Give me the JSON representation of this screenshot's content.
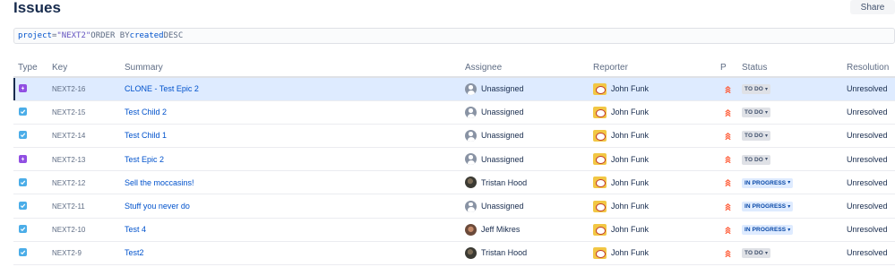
{
  "header": {
    "title": "Issues",
    "share_label": "Share"
  },
  "jql": {
    "field": "project",
    "operator": "=",
    "value": "\"NEXT2\"",
    "order": "ORDER BY",
    "order_field": "created",
    "direction": "DESC"
  },
  "columns": {
    "type": "Type",
    "key": "Key",
    "summary": "Summary",
    "assignee": "Assignee",
    "reporter": "Reporter",
    "priority": "P",
    "status": "Status",
    "resolution": "Resolution"
  },
  "rows": [
    {
      "type": "epic",
      "key": "NEXT2-16",
      "summary": "CLONE - Test Epic 2",
      "assignee": "Unassigned",
      "assignee_avatar": "unassigned",
      "reporter": "John Funk",
      "priority": "highest",
      "status": "TO DO",
      "status_kind": "todo",
      "resolution": "Unresolved",
      "selected": true
    },
    {
      "type": "task",
      "key": "NEXT2-15",
      "summary": "Test Child 2",
      "assignee": "Unassigned",
      "assignee_avatar": "unassigned",
      "reporter": "John Funk",
      "priority": "highest",
      "status": "TO DO",
      "status_kind": "todo",
      "resolution": "Unresolved"
    },
    {
      "type": "task",
      "key": "NEXT2-14",
      "summary": "Test Child 1",
      "assignee": "Unassigned",
      "assignee_avatar": "unassigned",
      "reporter": "John Funk",
      "priority": "highest",
      "status": "TO DO",
      "status_kind": "todo",
      "resolution": "Unresolved"
    },
    {
      "type": "epic",
      "key": "NEXT2-13",
      "summary": "Test Epic 2",
      "assignee": "Unassigned",
      "assignee_avatar": "unassigned",
      "reporter": "John Funk",
      "priority": "highest",
      "status": "TO DO",
      "status_kind": "todo",
      "resolution": "Unresolved"
    },
    {
      "type": "task",
      "key": "NEXT2-12",
      "summary": "Sell the moccasins!",
      "assignee": "Tristan Hood",
      "assignee_avatar": "tristan",
      "reporter": "John Funk",
      "priority": "highest",
      "status": "IN PROGRESS",
      "status_kind": "inprogress",
      "resolution": "Unresolved"
    },
    {
      "type": "task",
      "key": "NEXT2-11",
      "summary": "Stuff you never do",
      "assignee": "Unassigned",
      "assignee_avatar": "unassigned",
      "reporter": "John Funk",
      "priority": "highest",
      "status": "IN PROGRESS",
      "status_kind": "inprogress",
      "resolution": "Unresolved"
    },
    {
      "type": "task",
      "key": "NEXT2-10",
      "summary": "Test 4",
      "assignee": "Jeff Mikres",
      "assignee_avatar": "jeff",
      "reporter": "John Funk",
      "priority": "highest",
      "status": "IN PROGRESS",
      "status_kind": "inprogress",
      "resolution": "Unresolved"
    },
    {
      "type": "task",
      "key": "NEXT2-9",
      "summary": "Test2",
      "assignee": "Tristan Hood",
      "assignee_avatar": "tristan",
      "reporter": "John Funk",
      "priority": "highest",
      "status": "TO DO",
      "status_kind": "todo",
      "resolution": "Unresolved"
    }
  ],
  "colors": {
    "link": "#0052cc",
    "epic": "#904ee2",
    "task": "#4bade8",
    "priority_highest": "#ff5630",
    "selected_row": "#deebff"
  }
}
